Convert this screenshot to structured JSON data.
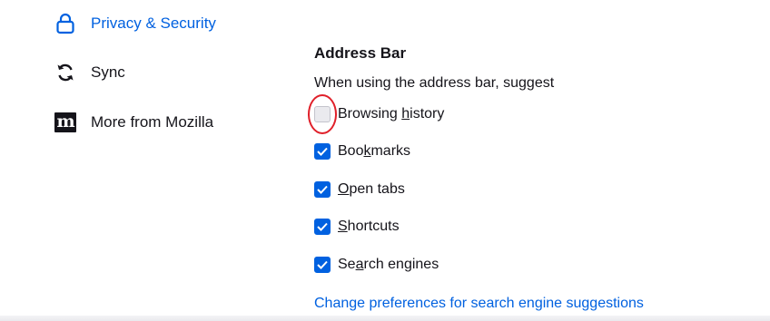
{
  "sidebar": {
    "items": [
      {
        "label": "Privacy & Security",
        "icon": "lock-icon",
        "selected": true
      },
      {
        "label": "Sync",
        "icon": "sync-icon",
        "selected": false
      },
      {
        "label": "More from Mozilla",
        "icon": "mozilla-logo-icon",
        "selected": false,
        "logo_text": "m"
      }
    ]
  },
  "address_bar": {
    "title": "Address Bar",
    "description": "When using the address bar, suggest",
    "options": [
      {
        "pre": "Browsing ",
        "accel": "h",
        "post": "istory",
        "checked": false,
        "highlighted": true
      },
      {
        "pre": "Boo",
        "accel": "k",
        "post": "marks",
        "checked": true
      },
      {
        "pre": "",
        "accel": "O",
        "post": "pen tabs",
        "checked": true
      },
      {
        "pre": "",
        "accel": "S",
        "post": "hortcuts",
        "checked": true
      },
      {
        "pre": "Se",
        "accel": "a",
        "post": "rch engines",
        "checked": true
      }
    ],
    "link": "Change preferences for search engine suggestions"
  },
  "colors": {
    "accent": "#0061e0",
    "highlight_ring": "#e0202a",
    "text": "#15141a"
  }
}
